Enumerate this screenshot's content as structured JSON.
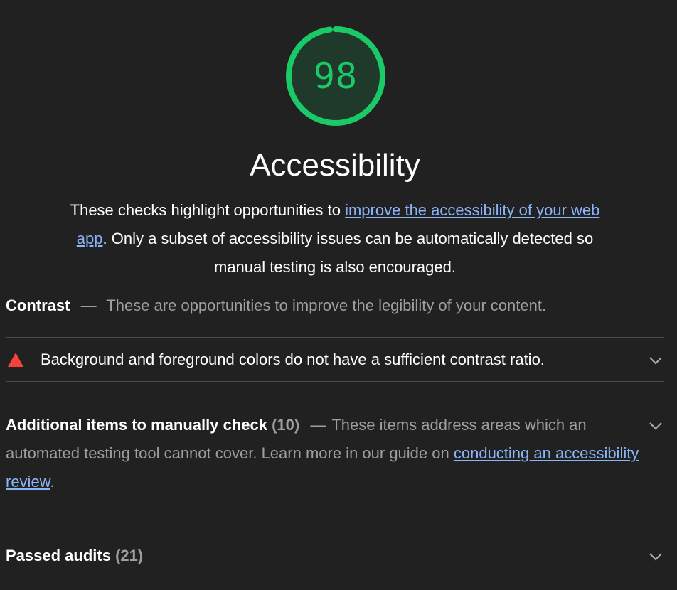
{
  "gauge": {
    "score": "98",
    "fraction": 0.98,
    "color": "#1ac968"
  },
  "category": {
    "title": "Accessibility",
    "desc_before": "These checks highlight opportunities to ",
    "desc_link": "improve the accessibility of your web app",
    "desc_after": ". Only a subset of accessibility issues can be automatically detected so manual testing is also encouraged."
  },
  "contrast_group": {
    "title": "Contrast",
    "separator": "—",
    "description": "These are opportunities to improve the legibility of your content."
  },
  "audits": [
    {
      "icon": "warning-triangle-icon",
      "title": "Background and foreground colors do not have a sufficient contrast ratio."
    }
  ],
  "manual_group": {
    "title": "Additional items to manually check",
    "count": "(10)",
    "separator": "—",
    "desc_before": "These items address areas which an automated testing tool cannot cover. Learn more in our guide on ",
    "desc_link": "conducting an accessibility review",
    "desc_after": "."
  },
  "passed_group": {
    "title": "Passed audits",
    "count": "(21)"
  },
  "colors": {
    "background": "#212121",
    "pass": "#1ac968",
    "fail": "#f4433a",
    "link": "#8ab4f8"
  }
}
